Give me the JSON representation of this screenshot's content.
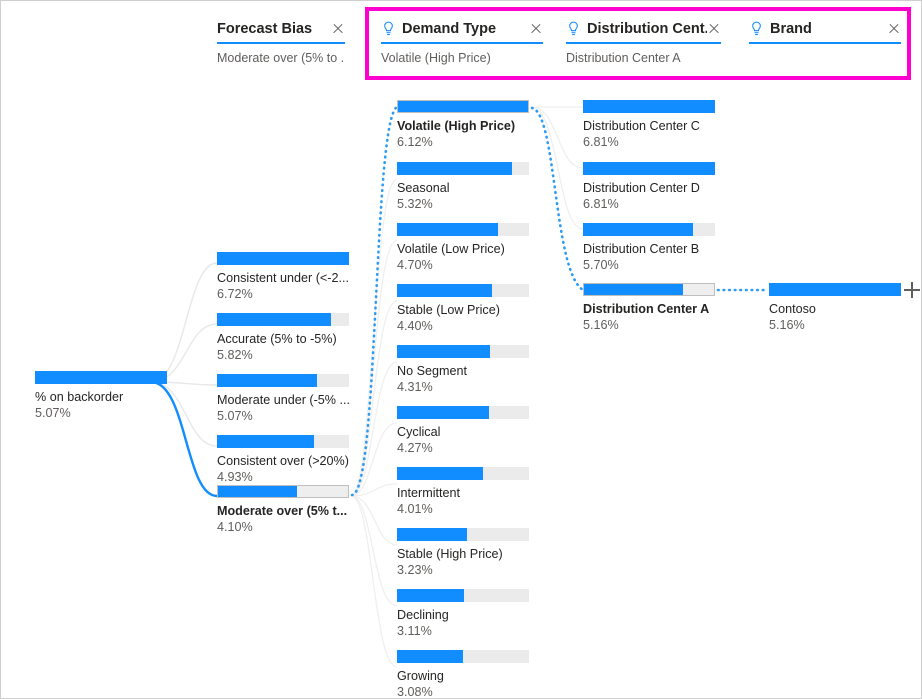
{
  "colors": {
    "bar_fill": "#118DFF",
    "bar_track": "#ebebeb",
    "accent_underline": "#118DFF",
    "annotation": "#ff00d0",
    "text_primary": "#252423",
    "text_secondary": "#605e5c",
    "link_active": "#118DFF",
    "link_inactive": "#e6e6e6"
  },
  "header": {
    "levels": [
      {
        "title": "Forecast Bias",
        "subtitle": "Moderate over (5% to ...",
        "ai_split": false,
        "close_label": "close-level",
        "bulb_icon": "lightbulb-icon"
      },
      {
        "title": "Demand Type",
        "subtitle": "Volatile (High Price)",
        "ai_split": true,
        "close_label": "close-level",
        "bulb_icon": "lightbulb-icon"
      },
      {
        "title": "Distribution Cent...",
        "subtitle": "Distribution Center A",
        "ai_split": true,
        "close_label": "close-level",
        "bulb_icon": "lightbulb-icon"
      },
      {
        "title": "Brand",
        "subtitle": "",
        "ai_split": true,
        "close_label": "close-level",
        "bulb_icon": "lightbulb-icon"
      }
    ]
  },
  "add_level": {
    "icon": "plus-icon",
    "label": "+"
  },
  "chart_data": {
    "type": "tree",
    "title": "% on backorder decomposition tree",
    "measure": "% on backorder",
    "levels": [
      "Root",
      "Forecast Bias",
      "Demand Type",
      "Distribution Center",
      "Brand"
    ],
    "root": {
      "label": "% on backorder",
      "value": "5.07%",
      "number": 5.07,
      "bar_ratio": 1.0,
      "selected": true
    },
    "columns": [
      {
        "level": "Forecast Bias",
        "nodes": [
          {
            "label": "Consistent under (<-2...",
            "value": "6.72%",
            "number": 6.72,
            "bar_ratio": 1.0,
            "selected": false
          },
          {
            "label": "Accurate (5% to -5%)",
            "value": "5.82%",
            "number": 5.82,
            "bar_ratio": 0.866,
            "selected": false
          },
          {
            "label": "Moderate under (-5% ...",
            "value": "5.07%",
            "number": 5.07,
            "bar_ratio": 0.754,
            "selected": false
          },
          {
            "label": "Consistent over (>20%)",
            "value": "4.93%",
            "number": 4.93,
            "bar_ratio": 0.733,
            "selected": false
          },
          {
            "label": "Moderate over (5% t...",
            "value": "4.10%",
            "number": 4.1,
            "bar_ratio": 0.61,
            "selected": true
          }
        ]
      },
      {
        "level": "Demand Type",
        "nodes": [
          {
            "label": "Volatile (High Price)",
            "value": "6.12%",
            "number": 6.12,
            "bar_ratio": 1.0,
            "selected": true
          },
          {
            "label": "Seasonal",
            "value": "5.32%",
            "number": 5.32,
            "bar_ratio": 0.869,
            "selected": false
          },
          {
            "label": "Volatile (Low Price)",
            "value": "4.70%",
            "number": 4.7,
            "bar_ratio": 0.768,
            "selected": false
          },
          {
            "label": "Stable (Low Price)",
            "value": "4.40%",
            "number": 4.4,
            "bar_ratio": 0.719,
            "selected": false
          },
          {
            "label": "No Segment",
            "value": "4.31%",
            "number": 4.31,
            "bar_ratio": 0.704,
            "selected": false
          },
          {
            "label": "Cyclical",
            "value": "4.27%",
            "number": 4.27,
            "bar_ratio": 0.698,
            "selected": false
          },
          {
            "label": "Intermittent",
            "value": "4.01%",
            "number": 4.01,
            "bar_ratio": 0.655,
            "selected": false
          },
          {
            "label": "Stable (High Price)",
            "value": "3.23%",
            "number": 3.23,
            "bar_ratio": 0.528,
            "selected": false
          },
          {
            "label": "Declining",
            "value": "3.11%",
            "number": 3.11,
            "bar_ratio": 0.508,
            "selected": false
          },
          {
            "label": "Growing",
            "value": "3.08%",
            "number": 3.08,
            "bar_ratio": 0.503,
            "selected": false
          }
        ]
      },
      {
        "level": "Distribution Center",
        "nodes": [
          {
            "label": "Distribution Center C",
            "value": "6.81%",
            "number": 6.81,
            "bar_ratio": 1.0,
            "selected": false
          },
          {
            "label": "Distribution Center D",
            "value": "6.81%",
            "number": 6.81,
            "bar_ratio": 1.0,
            "selected": false
          },
          {
            "label": "Distribution Center B",
            "value": "5.70%",
            "number": 5.7,
            "bar_ratio": 0.837,
            "selected": false
          },
          {
            "label": "Distribution Center A",
            "value": "5.16%",
            "number": 5.16,
            "bar_ratio": 0.758,
            "selected": true
          }
        ]
      },
      {
        "level": "Brand",
        "nodes": [
          {
            "label": "Contoso",
            "value": "5.16%",
            "number": 5.16,
            "bar_ratio": 1.0,
            "selected": false
          }
        ]
      }
    ]
  }
}
